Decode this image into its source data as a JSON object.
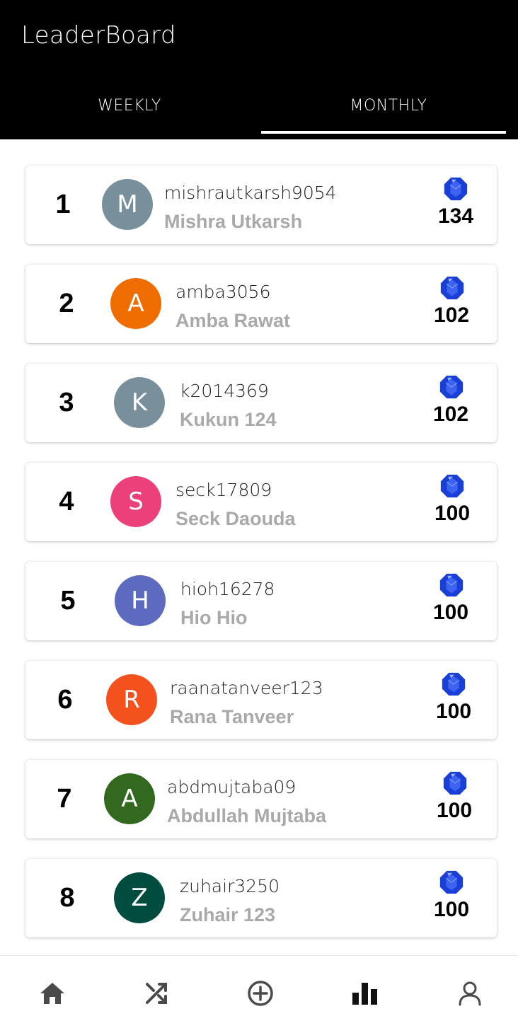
{
  "app": {
    "title": "LeaderBoard"
  },
  "tabs": [
    {
      "label": "WEEKLY",
      "selected": false
    },
    {
      "label": "MONTHLY",
      "selected": true
    }
  ],
  "gem_color": "#1a3fd6",
  "entries": [
    {
      "rank": "1",
      "initial": "M",
      "avatar_color": "#78909c",
      "username": "mishrautkarsh9054",
      "name": "Mishra Utkarsh",
      "points": "134"
    },
    {
      "rank": "2",
      "initial": "A",
      "avatar_color": "#ef6c00",
      "username": "amba3056",
      "name": "Amba Rawat",
      "points": "102"
    },
    {
      "rank": "3",
      "initial": "K",
      "avatar_color": "#78909c",
      "username": "k2014369",
      "name": "Kukun 124",
      "points": "102"
    },
    {
      "rank": "4",
      "initial": "S",
      "avatar_color": "#ec407a",
      "username": "seck17809",
      "name": "Seck Daouda",
      "points": "100"
    },
    {
      "rank": "5",
      "initial": "H",
      "avatar_color": "#5c6bc0",
      "username": "hioh16278",
      "name": "Hio Hio",
      "points": "100"
    },
    {
      "rank": "6",
      "initial": "R",
      "avatar_color": "#f4511e",
      "username": "raanatanveer123",
      "name": "Rana Tanveer",
      "points": "100"
    },
    {
      "rank": "7",
      "initial": "A",
      "avatar_color": "#33691e",
      "username": "abdmujtaba09",
      "name": "Abdullah Mujtaba",
      "points": "100"
    },
    {
      "rank": "8",
      "initial": "Z",
      "avatar_color": "#004d40",
      "username": "zuhair3250",
      "name": "Zuhair 123",
      "points": "100"
    }
  ],
  "bottom_nav": [
    {
      "icon": "home-icon",
      "active": false
    },
    {
      "icon": "shuffle-icon",
      "active": false
    },
    {
      "icon": "add-circle-icon",
      "active": false
    },
    {
      "icon": "leaderboard-icon",
      "active": true
    },
    {
      "icon": "profile-icon",
      "active": false
    }
  ]
}
